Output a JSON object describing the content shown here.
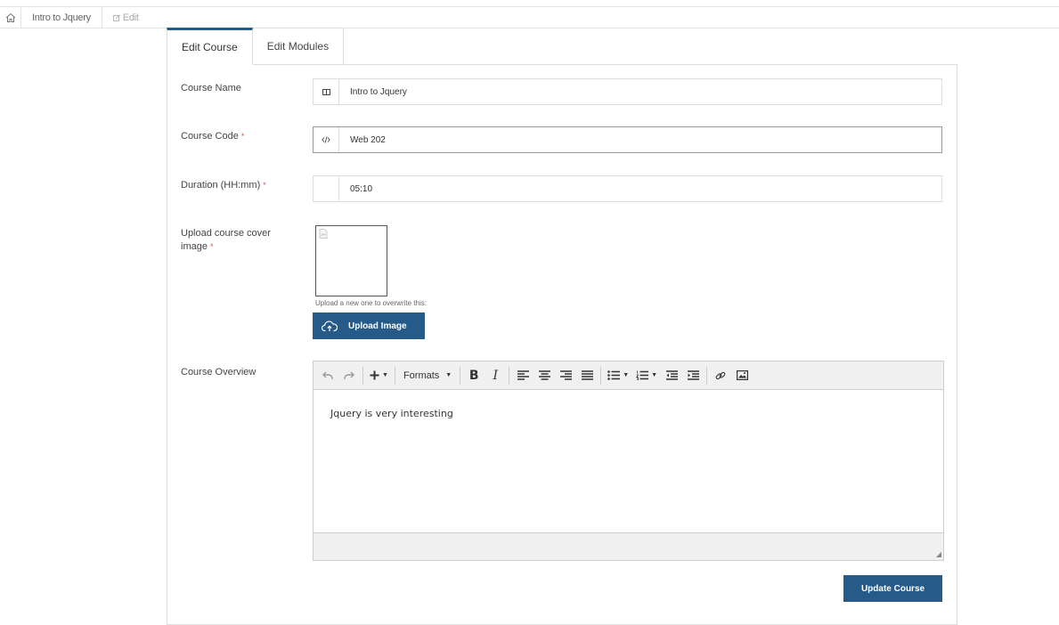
{
  "breadcrumb": {
    "items": [
      "Intro to Jquery",
      "Edit"
    ]
  },
  "tabs": [
    {
      "label": "Edit Course",
      "active": true
    },
    {
      "label": "Edit Modules",
      "active": false
    }
  ],
  "form": {
    "course_name": {
      "label": "Course Name",
      "value": "Intro to Jquery",
      "icon": "columns-icon"
    },
    "course_code": {
      "label": "Course Code",
      "required": "*",
      "value": "Web 202",
      "icon": "code-icon"
    },
    "duration": {
      "label": "Duration (HH:mm)",
      "required": "*",
      "value": "05:10"
    },
    "cover": {
      "label": "Upload course cover image",
      "required": "*",
      "hint": "Upload a new one to overwrite this:",
      "button_label": "Upload Image",
      "icon": "cloud-upload-icon"
    },
    "overview": {
      "label": "Course Overview",
      "content": "Jquery is very interesting",
      "formats_label": "Formats"
    },
    "submit_label": "Update Course"
  },
  "colors": {
    "primary": "#265a88",
    "required": "#d9534f"
  }
}
